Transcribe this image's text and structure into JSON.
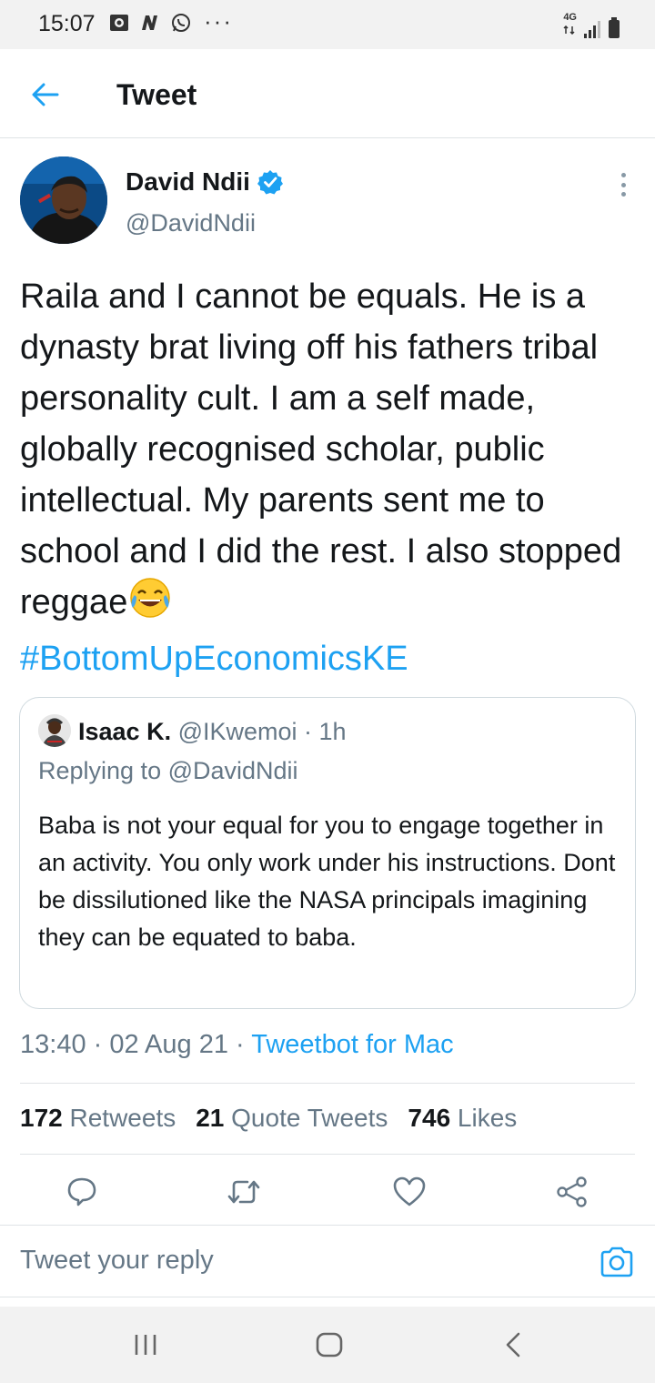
{
  "status_bar": {
    "time": "15:07",
    "dots": "···",
    "network": "4G",
    "icons": [
      "image-icon",
      "n-app-icon",
      "whatsapp-icon",
      "signal-icon",
      "battery-icon"
    ]
  },
  "header": {
    "title": "Tweet",
    "back_icon": "back-arrow-icon"
  },
  "tweet": {
    "author_name": "David Ndii",
    "author_handle": "@DavidNdii",
    "verified": true,
    "text": "Raila and I cannot be equals. He is a dynasty brat living off his fathers tribal personality cult. I am a self made, globally recognised scholar, public intellectual.  My parents sent me to school and I did the rest. I also stopped reggae",
    "emoji": "😂",
    "hashtag": "#BottomUpEconomicsKE",
    "timestamp": "13:40 · 02 Aug 21 · ",
    "source_app": "Tweetbot for Mac",
    "stats": {
      "retweets_count": "172",
      "retweets_label": "Retweets",
      "quote_count": "21",
      "quote_label": "Quote Tweets",
      "likes_count": "746",
      "likes_label": "Likes"
    }
  },
  "quoted": {
    "name": "Isaac K.",
    "handle_time": "@IKwemoi · 1h",
    "replying_prefix": "Replying to ",
    "replying_to": "@DavidNdii",
    "text": "Baba is not your equal for you to engage together in an activity. You only work under his instructions. Dont be dissilutioned  like the NASA principals imagining they can be equated to baba."
  },
  "actions": [
    "reply-icon",
    "retweet-icon",
    "like-icon",
    "share-icon"
  ],
  "reply_bar": {
    "placeholder": "Tweet your reply"
  },
  "colors": {
    "accent": "#1da1f2",
    "secondary_text": "#657786",
    "border": "#dfe3e6"
  }
}
